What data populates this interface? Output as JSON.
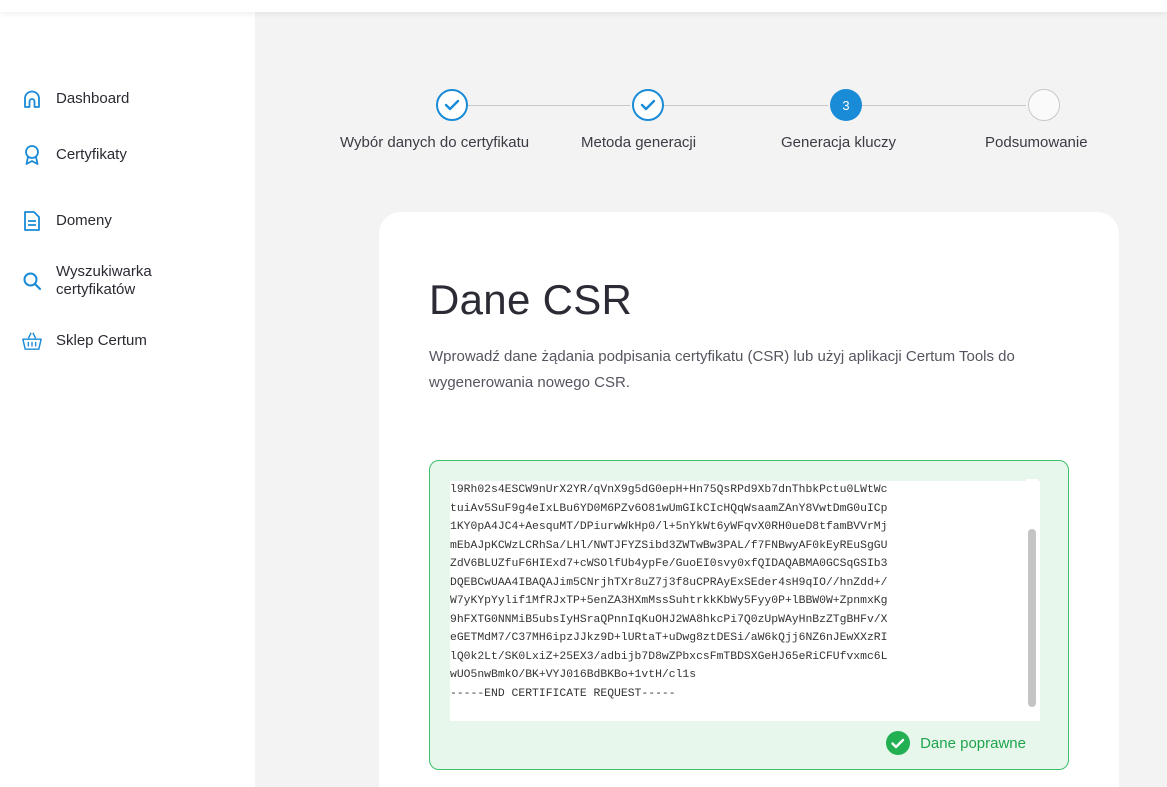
{
  "sidebar": {
    "items": [
      {
        "label": "Dashboard",
        "icon": "home-icon"
      },
      {
        "label": "Certyfikaty",
        "icon": "badge-icon"
      },
      {
        "label": "Domeny",
        "icon": "document-icon"
      },
      {
        "label": "Wyszukiwarka certyfikatów",
        "icon": "search-icon"
      },
      {
        "label": "Sklep Certum",
        "icon": "basket-icon"
      }
    ]
  },
  "stepper": {
    "steps": [
      {
        "label": "Wybór danych do certyfikatu",
        "state": "done"
      },
      {
        "label": "Metoda generacji",
        "state": "done"
      },
      {
        "label": "Generacja kluczy",
        "state": "active",
        "number": "3"
      },
      {
        "label": "Podsumowanie",
        "state": "todo"
      }
    ]
  },
  "card": {
    "title": "Dane CSR",
    "description": "Wprowadź dane żądania podpisania certyfikatu (CSR) lub użyj aplikacji Certum Tools do wygenerowania nowego CSR.",
    "csr_lines": [
      "l9Rh02s4ESCW9nUrX2YR/qVnX9g5dG0epH+Hn75QsRPd9Xb7dnThbkPctu0LWtWc",
      "tuiAv5SuF9g4eIxLBu6YD0M6PZv6O81wUmGIkCIcHQqWsaamZAnY8VwtDmG0uICp",
      "1KY0pA4JC4+AesquMT/DPiurwWkHp0/l+5nYkWt6yWFqvX0RH0ueD8tfamBVVrMj",
      "mEbAJpKCWzLCRhSa/LHl/NWTJFYZSibd3ZWTwBw3PAL/f7FNBwyAF0kEyREuSgGU",
      "ZdV6BLUZfuF6HIExd7+cWSOlfUb4ypFe/GuoEI0svy0xfQIDAQABMA0GCSqGSIb3",
      "DQEBCwUAA4IBAQAJim5CNrjhTXr8uZ7j3f8uCPRAyExSEder4sH9qIO//hnZdd+/",
      "W7yKYpYylif1MfRJxTP+5enZA3HXmMssSuhtrkkKbWy5Fyy0P+lBBW0W+ZpnmxKg",
      "9hFXTG0NNMiB5ubsIyHSraQPnnIqKuOHJ2WA8hkcPi7Q0zUpWAyHnBzZTgBHFv/X",
      "eGETMdM7/C37MH6ipzJJkz9D+lURtaT+uDwg8ztDESi/aW6kQjj6NZ6nJEwXXzRI",
      "lQ0k2Lt/SK0LxiZ+25EX3/adbijb7D8wZPbxcsFmTBDSXGeHJ65eRiCFUfvxmc6L",
      "wUO5nwBmkO/BK+VYJ016BdBKBo+1vtH/cl1s",
      "-----END CERTIFICATE REQUEST-----"
    ],
    "valid_label": "Dane poprawne"
  },
  "colors": {
    "accent": "#1a8bd6",
    "success": "#1fa44d",
    "success_bg": "#e8f7ec"
  }
}
